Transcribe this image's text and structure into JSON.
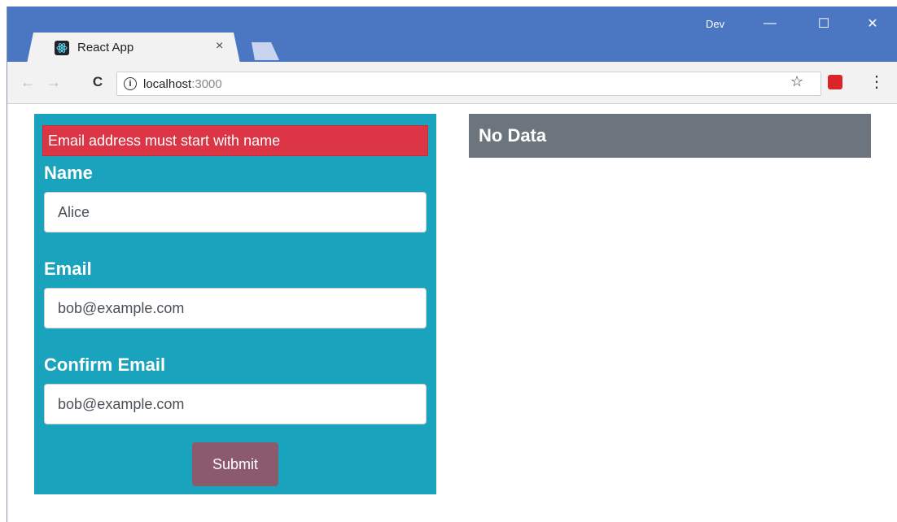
{
  "browser": {
    "tab_title": "React App",
    "tab_close": "×",
    "profile": "Dev",
    "controls": {
      "minimize": "—",
      "maximize": "☐",
      "close": "✕"
    },
    "nav": {
      "back": "←",
      "forward": "→",
      "reload": "C"
    },
    "url_host": "localhost",
    "url_port": ":3000",
    "info_glyph": "i",
    "bookmark_glyph": "☆",
    "menu_glyph": "⋮",
    "icons": [
      "react-favicon",
      "back-icon",
      "forward-icon",
      "reload-icon",
      "info-icon",
      "bookmark-star-icon",
      "extension-icon",
      "menu-icon"
    ]
  },
  "form": {
    "error": "Email address must start with name",
    "name_label": "Name",
    "name_value": "Alice",
    "email_label": "Email",
    "email_value": "bob@example.com",
    "confirm_label": "Confirm Email",
    "confirm_value": "bob@example.com",
    "submit_label": "Submit"
  },
  "summary": {
    "title": "No Data"
  },
  "colors": {
    "titlebar": "#4a76c2",
    "form_panel": "#1aa3bc",
    "error": "#dc3545",
    "submit": "#8c5a6d",
    "summary": "#6c757d"
  }
}
